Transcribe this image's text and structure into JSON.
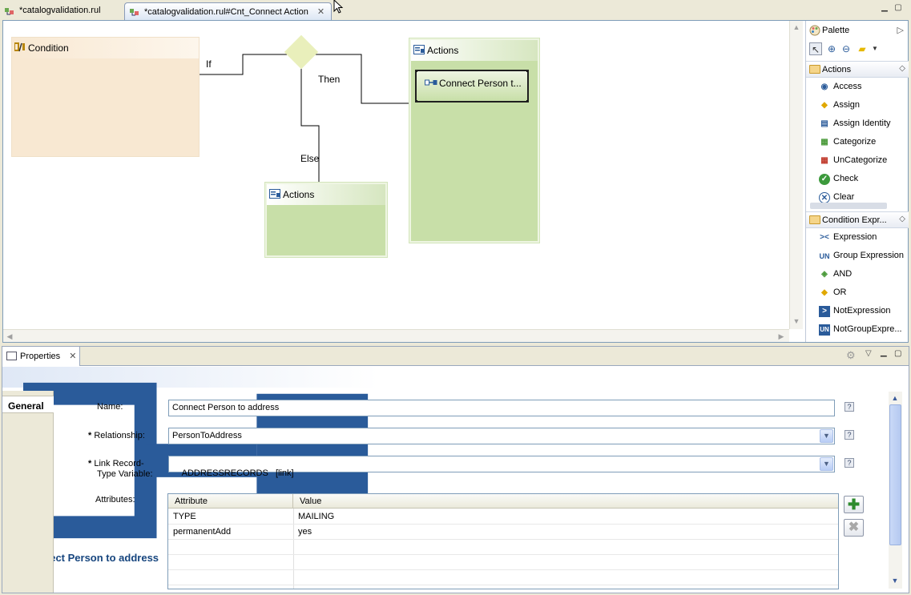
{
  "editor_tabs": [
    {
      "label": "*catalogvalidation.rul"
    },
    {
      "label": "*catalogvalidation.rul#Cnt_Connect Action"
    }
  ],
  "diagram": {
    "condition_title": "Condition",
    "then_actions_title": "Actions",
    "else_actions_title": "Actions",
    "if_label": "If",
    "then_label": "Then",
    "else_label": "Else",
    "action_item_label": "Connect Person t..."
  },
  "palette": {
    "title": "Palette",
    "actions_drawer": "Actions",
    "actions": [
      "Access",
      "Assign",
      "Assign Identity",
      "Categorize",
      "UnCategorize",
      "Check",
      "Clear"
    ],
    "condition_drawer": "Condition Expr...",
    "conditions": [
      "Expression",
      "Group Expression",
      "AND",
      "OR",
      "NotExpression",
      "NotGroupExpre..."
    ]
  },
  "properties": {
    "tab_label": "Properties",
    "title": "Connect Person to address",
    "section_tab": "General",
    "name_label": "Name:",
    "name_value": "Connect Person to address",
    "relationship_label": "Relationship:",
    "relationship_value": "PersonToAddress",
    "link_label_line1": "Link Record-",
    "link_label_line2": "Type Variable:",
    "link_value": "ADDRESSRECORDS   [link]",
    "attributes_label": "Attributes:",
    "required_mark": "*",
    "help_glyph": "?",
    "table": {
      "columns": [
        "Attribute",
        "Value"
      ],
      "rows": [
        {
          "attribute": "TYPE",
          "value": "MAILING"
        },
        {
          "attribute": "permanentAdd",
          "value": "yes"
        }
      ]
    }
  },
  "colors": {
    "condition_fill": "#f8e8d2",
    "actions_fill": "#c8dfa8",
    "title_blue": "#16457e",
    "editor_border": "#7f9db9"
  }
}
